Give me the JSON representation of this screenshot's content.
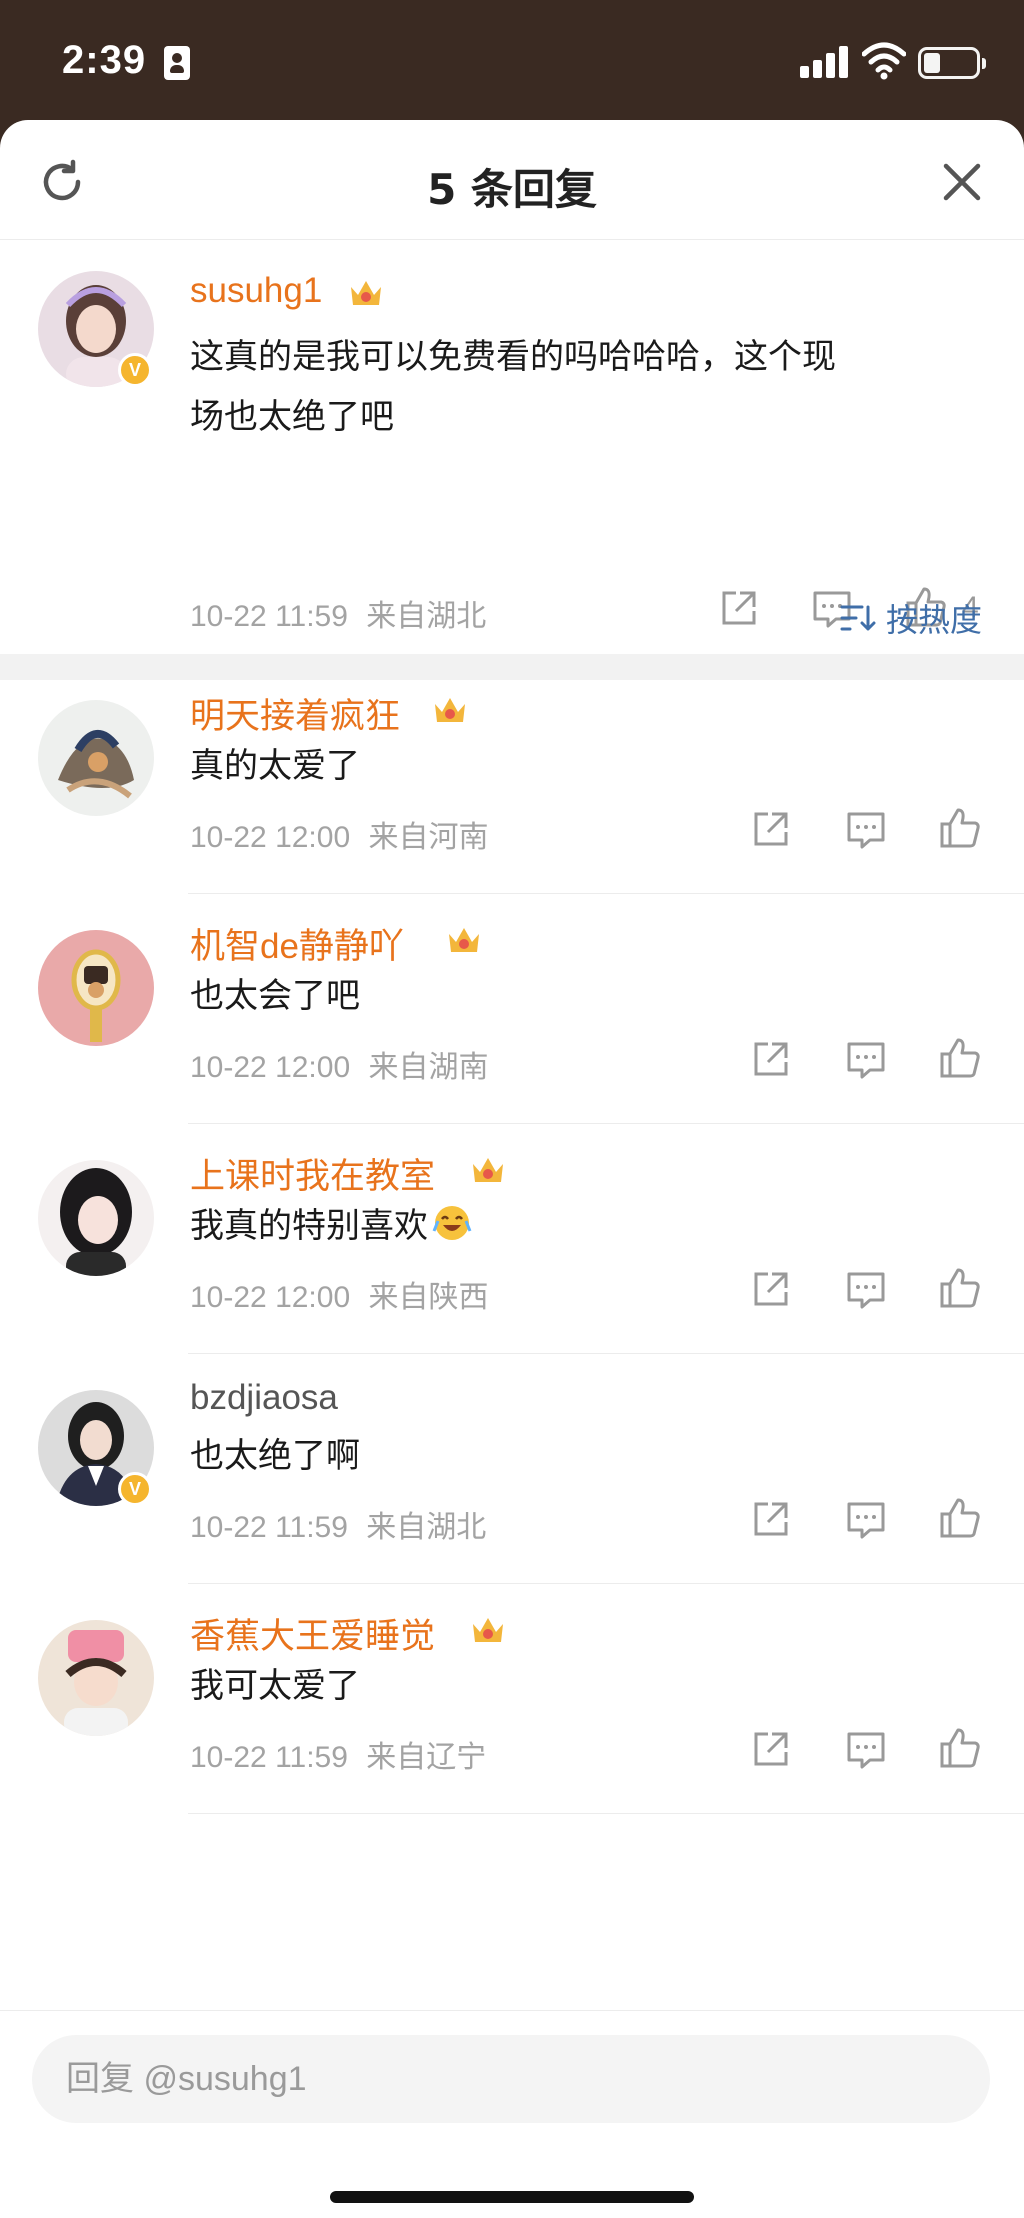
{
  "status_bar": {
    "time": "2:39"
  },
  "sheet": {
    "title": "5 条回复",
    "icons": {
      "refresh": "refresh-icon",
      "close": "close-icon"
    }
  },
  "main_comment": {
    "username": "susuhg1",
    "verified": true,
    "text_line1": "这真的是我可以免费看的吗哈哈哈，这个现",
    "text_line2": "场也太绝了吧",
    "time": "10-22 11:59",
    "location": "来自湖北",
    "like_count": "4"
  },
  "sort": {
    "label": "按热度"
  },
  "replies": [
    {
      "username": "明天接着疯狂",
      "text": "真的太爱了",
      "time": "10-22 12:00",
      "location": "来自河南",
      "vip": true,
      "verified": false
    },
    {
      "username": "机智de静静吖",
      "text": "也太会了吧",
      "time": "10-22 12:00",
      "location": "来自湖南",
      "vip": true,
      "verified": false
    },
    {
      "username": "上课时我在教室",
      "text": "我真的特别喜欢",
      "time": "10-22 12:00",
      "location": "来自陕西",
      "vip": true,
      "verified": false,
      "emoji": "laughing-crying-emoji"
    },
    {
      "username": "bzdjiaosa",
      "text": "也太绝了啊",
      "time": "10-22 11:59",
      "location": "来自湖北",
      "vip": false,
      "verified": true
    },
    {
      "username": "香蕉大王爱睡觉",
      "text": "我可太爱了",
      "time": "10-22 11:59",
      "location": "来自辽宁",
      "vip": true,
      "verified": false
    }
  ],
  "reply_input": {
    "placeholder": "回复 @susuhg1"
  },
  "colors": {
    "username": "#e8731c",
    "link_blue": "#3f6ea8",
    "meta": "#a3a3a3",
    "status_bg": "#3a2a22"
  }
}
